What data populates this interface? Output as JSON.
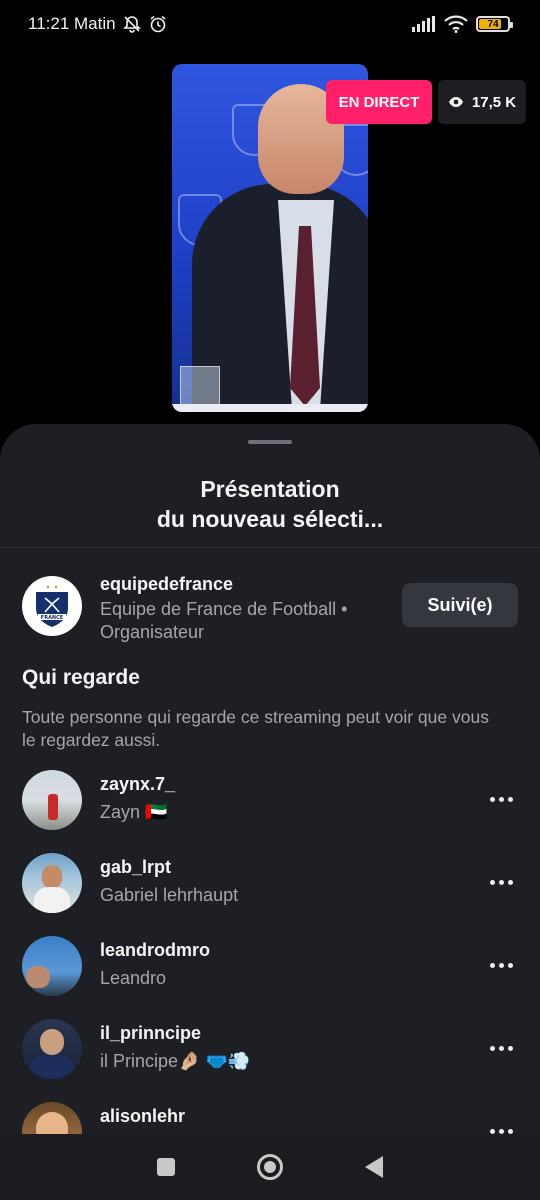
{
  "status_bar": {
    "time": "11:21 Matin",
    "battery": "74",
    "battery_level": 0.74,
    "icons": [
      "bell-off-icon",
      "alarm-icon",
      "signal-icon",
      "wifi-icon",
      "battery-icon"
    ]
  },
  "live": {
    "badge": "EN DIRECT",
    "viewers": "17,5 K",
    "badge_color": "#ff1f6b"
  },
  "sheet": {
    "title_line1": "Présentation",
    "title_line2": "du nouveau sélecti..."
  },
  "organizer": {
    "username": "equipedefrance",
    "subtitle": "Equipe de France de Football • Organisateur",
    "follow_label": "Suivi(e)",
    "avatar_text": "FRANCE"
  },
  "watching": {
    "title": "Qui regarde",
    "description": "Toute personne qui regarde ce streaming peut voir que vous le regardez aussi.",
    "viewers": [
      {
        "username": "zaynx.7_",
        "name": "Zayn 🇦🇪"
      },
      {
        "username": "gab_lrpt",
        "name": "Gabriel lehrhaupt"
      },
      {
        "username": "leandrodmro",
        "name": "Leandro"
      },
      {
        "username": "il_prinncipe",
        "name": "il Principe🤌🏼 🩲💨"
      },
      {
        "username": "alisonlehr",
        "name": ""
      }
    ]
  },
  "navbar": {
    "icons": [
      "recents-square-icon",
      "home-circle-icon",
      "back-triangle-icon"
    ]
  }
}
